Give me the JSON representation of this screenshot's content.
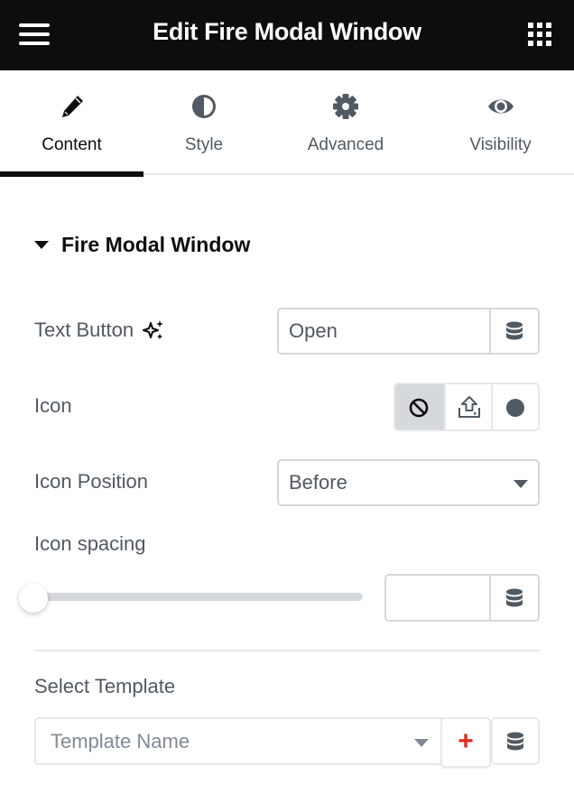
{
  "header": {
    "title": "Edit Fire Modal Window",
    "menu_icon": "hamburger-menu-icon",
    "apps_icon": "grid-apps-icon",
    "background": "#0c0d0e"
  },
  "tabs": [
    {
      "label": "Content",
      "icon": "pencil-icon",
      "active": true
    },
    {
      "label": "Style",
      "icon": "half-circle-contrast-icon",
      "active": false
    },
    {
      "label": "Advanced",
      "icon": "gear-icon",
      "active": false
    },
    {
      "label": "Visibility",
      "icon": "eye-icon",
      "active": false
    }
  ],
  "section": {
    "title": "Fire Modal Window",
    "expanded": true
  },
  "fields": {
    "text_button": {
      "label": "Text Button",
      "ai_icon": "sparkle-icon",
      "value": "Open",
      "dynamic_icon": "database-icon"
    },
    "icon": {
      "label": "Icon",
      "options": [
        {
          "name": "none",
          "icon": "ban-icon",
          "active": true
        },
        {
          "name": "upload",
          "icon": "upload-icon",
          "active": false
        },
        {
          "name": "icon-library",
          "icon": "circle-icon",
          "active": false
        }
      ]
    },
    "icon_position": {
      "label": "Icon Position",
      "selected": "Before"
    },
    "icon_spacing": {
      "label": "Icon spacing",
      "slider_fraction": 0,
      "value": "",
      "dynamic_icon": "database-icon"
    },
    "select_template": {
      "label": "Select Template",
      "placeholder": "Template Name",
      "add_label": "+",
      "dynamic_icon": "database-icon"
    }
  },
  "colors": {
    "text": "#515962",
    "active": "#0c0d0e",
    "border": "#d5d8dc",
    "add_accent": "#e0291c"
  }
}
